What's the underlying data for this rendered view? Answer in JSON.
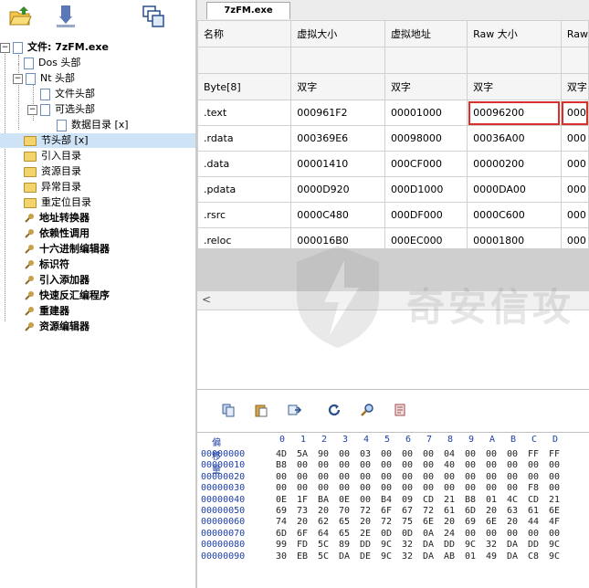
{
  "tree": {
    "root": "文件: 7zFM.exe",
    "dos_header": "Dos 头部",
    "nt_header": "Nt 头部",
    "file_header": "文件头部",
    "optional_header": "可选头部",
    "data_directory": "数据目录 [x]",
    "section_header": "节头部 [x]",
    "import_dir": "引入目录",
    "resource_dir": "资源目录",
    "exception_dir": "异常目录",
    "reloc_dir": "重定位目录",
    "address_converter": "地址转换器",
    "dependency_walker": "依赖性调用",
    "hex_editor": "十六进制编辑器",
    "identifier": "标识符",
    "import_adder": "引入添加器",
    "quick_disassembler": "快速反汇编程序",
    "rebuilder": "重建器",
    "resource_editor": "资源编辑器"
  },
  "tab": {
    "label": "7zFM.exe"
  },
  "sections_table": {
    "headers": [
      "名称",
      "虚拟大小",
      "虚拟地址",
      "Raw 大小",
      "Raw"
    ],
    "types": [
      "Byte[8]",
      "双字",
      "双字",
      "双字",
      "双字"
    ],
    "rows": [
      [
        ".text",
        "000961F2",
        "00001000",
        "00096200",
        "000"
      ],
      [
        ".rdata",
        "000369E6",
        "00098000",
        "00036A00",
        "000"
      ],
      [
        ".data",
        "00001410",
        "000CF000",
        "00000200",
        "000"
      ],
      [
        ".pdata",
        "0000D920",
        "000D1000",
        "0000DA00",
        "000"
      ],
      [
        ".rsrc",
        "0000C480",
        "000DF000",
        "0000C600",
        "000"
      ],
      [
        ".reloc",
        "000016B0",
        "000EC000",
        "00001800",
        "000"
      ]
    ]
  },
  "hex": {
    "offset_label": "偏移量",
    "columns": [
      "0",
      "1",
      "2",
      "3",
      "4",
      "5",
      "6",
      "7",
      "8",
      "9",
      "A",
      "B",
      "C",
      "D"
    ],
    "rows": [
      {
        "off": "00000000",
        "b": [
          "4D",
          "5A",
          "90",
          "00",
          "03",
          "00",
          "00",
          "00",
          "04",
          "00",
          "00",
          "00",
          "FF",
          "FF"
        ]
      },
      {
        "off": "00000010",
        "b": [
          "B8",
          "00",
          "00",
          "00",
          "00",
          "00",
          "00",
          "00",
          "40",
          "00",
          "00",
          "00",
          "00",
          "00"
        ]
      },
      {
        "off": "00000020",
        "b": [
          "00",
          "00",
          "00",
          "00",
          "00",
          "00",
          "00",
          "00",
          "00",
          "00",
          "00",
          "00",
          "00",
          "00"
        ]
      },
      {
        "off": "00000030",
        "b": [
          "00",
          "00",
          "00",
          "00",
          "00",
          "00",
          "00",
          "00",
          "00",
          "00",
          "00",
          "00",
          "F8",
          "00"
        ]
      },
      {
        "off": "00000040",
        "b": [
          "0E",
          "1F",
          "BA",
          "0E",
          "00",
          "B4",
          "09",
          "CD",
          "21",
          "B8",
          "01",
          "4C",
          "CD",
          "21"
        ]
      },
      {
        "off": "00000050",
        "b": [
          "69",
          "73",
          "20",
          "70",
          "72",
          "6F",
          "67",
          "72",
          "61",
          "6D",
          "20",
          "63",
          "61",
          "6E"
        ]
      },
      {
        "off": "00000060",
        "b": [
          "74",
          "20",
          "62",
          "65",
          "20",
          "72",
          "75",
          "6E",
          "20",
          "69",
          "6E",
          "20",
          "44",
          "4F"
        ]
      },
      {
        "off": "00000070",
        "b": [
          "6D",
          "6F",
          "64",
          "65",
          "2E",
          "0D",
          "0D",
          "0A",
          "24",
          "00",
          "00",
          "00",
          "00",
          "00"
        ]
      },
      {
        "off": "00000080",
        "b": [
          "99",
          "FD",
          "5C",
          "89",
          "DD",
          "9C",
          "32",
          "DA",
          "DD",
          "9C",
          "32",
          "DA",
          "DD",
          "9C"
        ]
      },
      {
        "off": "00000090",
        "b": [
          "30",
          "EB",
          "5C",
          "DA",
          "DE",
          "9C",
          "32",
          "DA",
          "AB",
          "01",
          "49",
          "DA",
          "C8",
          "9C"
        ]
      }
    ]
  },
  "watermark": "奇安信攻",
  "colors": {
    "highlight_border": "#d9302c",
    "selection": "#cfe3f7",
    "hex_offset": "#1d3fa6"
  }
}
